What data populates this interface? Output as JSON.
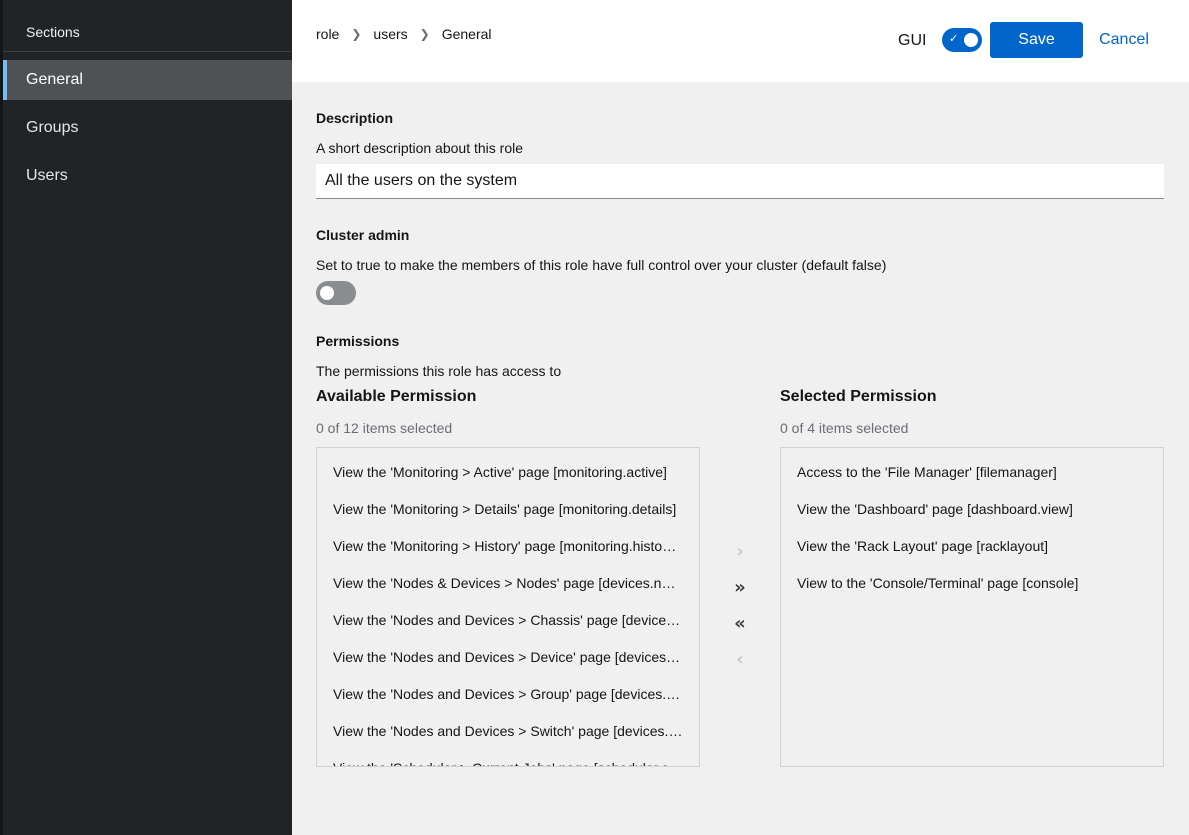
{
  "sidebar": {
    "heading": "Sections",
    "items": [
      {
        "label": "General",
        "active": true
      },
      {
        "label": "Groups",
        "active": false
      },
      {
        "label": "Users",
        "active": false
      }
    ]
  },
  "header": {
    "breadcrumb": [
      "role",
      "users",
      "General"
    ],
    "gui_label": "GUI",
    "gui_toggle_on": true,
    "save_label": "Save",
    "cancel_label": "Cancel"
  },
  "form": {
    "description": {
      "label": "Description",
      "helper": "A short description about this role",
      "value": "All the users on the system"
    },
    "cluster_admin": {
      "label": "Cluster admin",
      "helper": "Set to true to make the members of this role have full control over your cluster (default false)",
      "toggle_on": false
    },
    "permissions": {
      "label": "Permissions",
      "helper": "The permissions this role has access to",
      "available": {
        "title": "Available Permission",
        "status": "0 of 12 items selected",
        "items": [
          "View the 'Monitoring > Active' page [monitoring.active]",
          "View the 'Monitoring > Details' page [monitoring.details]",
          "View the 'Monitoring > History' page [monitoring.histo…",
          "View the 'Nodes & Devices > Nodes' page [devices.no…",
          "View the 'Nodes and Devices > Chassis' page [devices.…",
          "View the 'Nodes and Devices > Device' page [devices.…",
          "View the 'Nodes and Devices > Group' page [devices.g…",
          "View the 'Nodes and Devices > Switch' page [devices.s…",
          "View the 'Scheduler > Current Jobs' page [scheduler.c…"
        ]
      },
      "selected": {
        "title": "Selected Permission",
        "status": "0 of 4 items selected",
        "items": [
          "Access to the 'File Manager' [filemanager]",
          "View the 'Dashboard' page [dashboard.view]",
          "View the 'Rack Layout' page [racklayout]",
          "View to the 'Console/Terminal' page [console]"
        ]
      },
      "controls": {
        "add_selected": "›",
        "add_all": "»",
        "remove_all": "«",
        "remove_selected": "‹"
      }
    }
  },
  "icons": {
    "breadcrumb_separator": "chevron-right-icon",
    "toggle_check": "check-icon"
  },
  "colors": {
    "primary": "#0066cc",
    "sidebar_bg": "#212427",
    "sidebar_active_bg": "#4f5255",
    "sidebar_active_accent": "#73bcf7",
    "toggle_off": "#8a8d90"
  }
}
